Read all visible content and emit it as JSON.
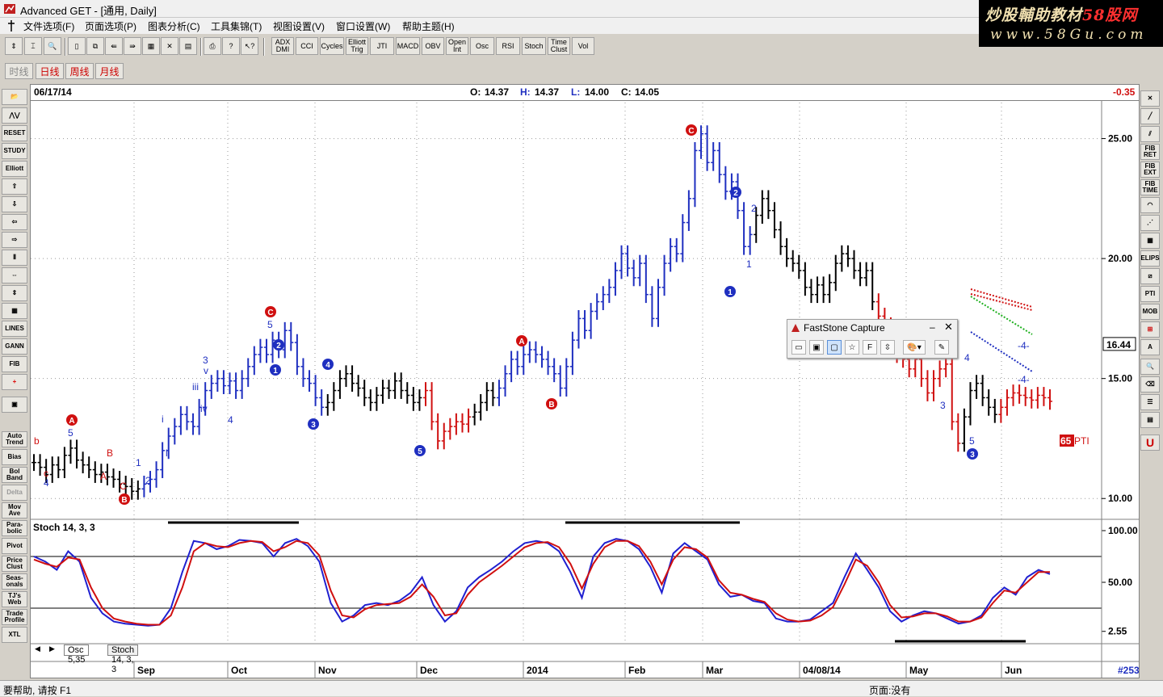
{
  "window": {
    "title": "Advanced GET - [通用, Daily]"
  },
  "watermark": {
    "line1_a": "炒股輔助教材",
    "line1_b": "58股网",
    "line2": "www.58Gu.com"
  },
  "menu": [
    "文件选项(F)",
    "页面选项(P)",
    "图表分析(C)",
    "工具集锦(T)",
    "视图设置(V)",
    "窗口设置(W)",
    "帮助主题(H)"
  ],
  "toolbar": {
    "indicators": [
      "ADX DMI",
      "CCI",
      "Cycles",
      "Elliott Trig",
      "JTI",
      "MACD",
      "OBV",
      "Open Int",
      "Osc",
      "RSI",
      "Stoch",
      "Time Clust",
      "Vol"
    ]
  },
  "period_tabs": [
    "时线",
    "日线",
    "周线",
    "月线"
  ],
  "left_tools": [
    "RESET",
    "STUDY",
    "Elliott",
    "LINES",
    "GANN",
    "FIB",
    "Auto Trend",
    "Bias",
    "Bol Band",
    "Delta",
    "Mov Ave",
    "Para-bolic",
    "Pivot",
    "Price Clust",
    "Seas-onals",
    "TJ's Web",
    "Trade Profile",
    "XTL"
  ],
  "right_tools": [
    "FIB RET",
    "FIB EXT",
    "FIB TIME",
    "ELIPS",
    "PTI",
    "MOB"
  ],
  "ohlc": {
    "date": "06/17/14",
    "o_label": "O:",
    "o": "14.37",
    "h_label": "H:",
    "h": "14.37",
    "l_label": "L:",
    "l": "14.00",
    "c_label": "C:",
    "c": "14.05",
    "change": "-0.35"
  },
  "last_price": "16.44",
  "pti": {
    "value": "65",
    "label": "PTI"
  },
  "faststone": {
    "title": "FastStone Capture"
  },
  "bottom_tabs": [
    "Osc 5,35",
    "Stoch 14, 3, 3"
  ],
  "status": {
    "left": "要帮助, 请按 F1",
    "right": "页面:没有",
    "bar_count": "#253"
  },
  "colors": {
    "wave_blue": "#1f2fc0",
    "wave_red": "#d01010",
    "bars_black": "#000000",
    "stoch_k": "#2020d0",
    "stoch_d": "#d01010"
  },
  "chart_data": [
    {
      "type": "line",
      "title": "",
      "ylim": [
        9.2,
        26.5
      ],
      "y_ticks": [
        "10.00",
        "15.00",
        "20.00",
        "25.00"
      ],
      "x_ticks": [
        "Sep",
        "Oct",
        "Nov",
        "Dec",
        "2014",
        "Feb",
        "Mar",
        "04/08/14",
        "May",
        "Jun"
      ],
      "series": [
        {
          "values": [
            11.5,
            11.3,
            11.0,
            11.4,
            11.2,
            11.8,
            12.1,
            11.6,
            11.4,
            11.2,
            11.0,
            11.1,
            10.9,
            10.8,
            10.6,
            10.5,
            10.3,
            10.4,
            10.6,
            10.8,
            11.2,
            12.0,
            12.6,
            13.0,
            13.5,
            13.2,
            13.0,
            13.8,
            14.5,
            14.8,
            15.0,
            14.7,
            14.9,
            14.5,
            15.0,
            15.5,
            16.0,
            16.3,
            16.0,
            16.6,
            16.2,
            17.0,
            16.5,
            15.5,
            15.0,
            14.8,
            14.2,
            13.8,
            14.0,
            14.5,
            15.0,
            15.2,
            14.8,
            14.6,
            14.2,
            14.0,
            14.3,
            14.6,
            14.5,
            14.9,
            14.5,
            14.3,
            14.0,
            14.2,
            14.5,
            13.2,
            12.4,
            12.8,
            13.0,
            13.2,
            13.1,
            13.4,
            13.6,
            14.0,
            14.5,
            14.2,
            14.6,
            15.2,
            15.8,
            15.5,
            16.0,
            16.2,
            16.0,
            15.8,
            15.5,
            15.2,
            14.6,
            15.5,
            16.6,
            17.5,
            17.0,
            17.8,
            18.2,
            18.5,
            18.8,
            19.5,
            20.2,
            19.6,
            19.2,
            19.8,
            18.5,
            17.5,
            18.8,
            19.8,
            20.5,
            20.2,
            21.5,
            22.5,
            24.5,
            25.2,
            24.0,
            24.5,
            23.5,
            22.8,
            23.2,
            22.0,
            20.5,
            21.0,
            21.8,
            22.5,
            22.0,
            21.2,
            20.5,
            20.0,
            19.8,
            19.5,
            18.8,
            18.5,
            18.9,
            18.5,
            19.0,
            19.8,
            20.2,
            20.0,
            19.5,
            19.2,
            19.5,
            18.2,
            17.6,
            17.2,
            16.6,
            16.0,
            15.8,
            15.4,
            15.8,
            15.0,
            14.4,
            15.0,
            15.4,
            15.6,
            13.2,
            12.3,
            13.4,
            14.5,
            14.8,
            14.2,
            13.8,
            13.5,
            13.8,
            14.2,
            14.4,
            14.3,
            14.2,
            14.1,
            14.3,
            14.2,
            14.05
          ]
        }
      ]
    },
    {
      "type": "line",
      "title": "Stoch 14, 3, 3",
      "ylim": [
        0,
        100
      ],
      "y_ticks": [
        "2.55",
        "50.00",
        "100.00"
      ],
      "series": [
        {
          "name": "%K",
          "values": [
            75,
            70,
            62,
            80,
            70,
            35,
            20,
            12,
            10,
            9,
            8,
            9,
            25,
            60,
            90,
            88,
            82,
            85,
            91,
            90,
            88,
            75,
            88,
            92,
            85,
            70,
            30,
            12,
            18,
            28,
            30,
            28,
            32,
            40,
            55,
            28,
            12,
            22,
            45,
            55,
            62,
            70,
            80,
            88,
            90,
            88,
            80,
            60,
            35,
            75,
            88,
            92,
            90,
            82,
            65,
            40,
            78,
            88,
            80,
            72,
            48,
            36,
            38,
            32,
            30,
            15,
            12,
            12,
            14,
            22,
            30,
            55,
            78,
            62,
            45,
            22,
            12,
            18,
            22,
            20,
            15,
            10,
            12,
            18,
            35,
            45,
            38,
            55,
            62,
            58
          ]
        },
        {
          "name": "%D",
          "values": [
            72,
            68,
            65,
            74,
            72,
            45,
            25,
            15,
            12,
            10,
            9,
            9,
            18,
            45,
            80,
            88,
            85,
            84,
            88,
            90,
            89,
            80,
            84,
            90,
            88,
            76,
            42,
            18,
            16,
            24,
            28,
            29,
            30,
            36,
            48,
            36,
            18,
            20,
            38,
            50,
            58,
            66,
            75,
            84,
            88,
            89,
            84,
            68,
            44,
            68,
            84,
            90,
            90,
            85,
            70,
            48,
            72,
            84,
            82,
            74,
            52,
            40,
            38,
            34,
            31,
            20,
            14,
            12,
            13,
            18,
            26,
            48,
            72,
            66,
            50,
            28,
            16,
            17,
            20,
            20,
            17,
            12,
            12,
            16,
            30,
            42,
            40,
            50,
            60,
            60
          ]
        }
      ]
    }
  ]
}
